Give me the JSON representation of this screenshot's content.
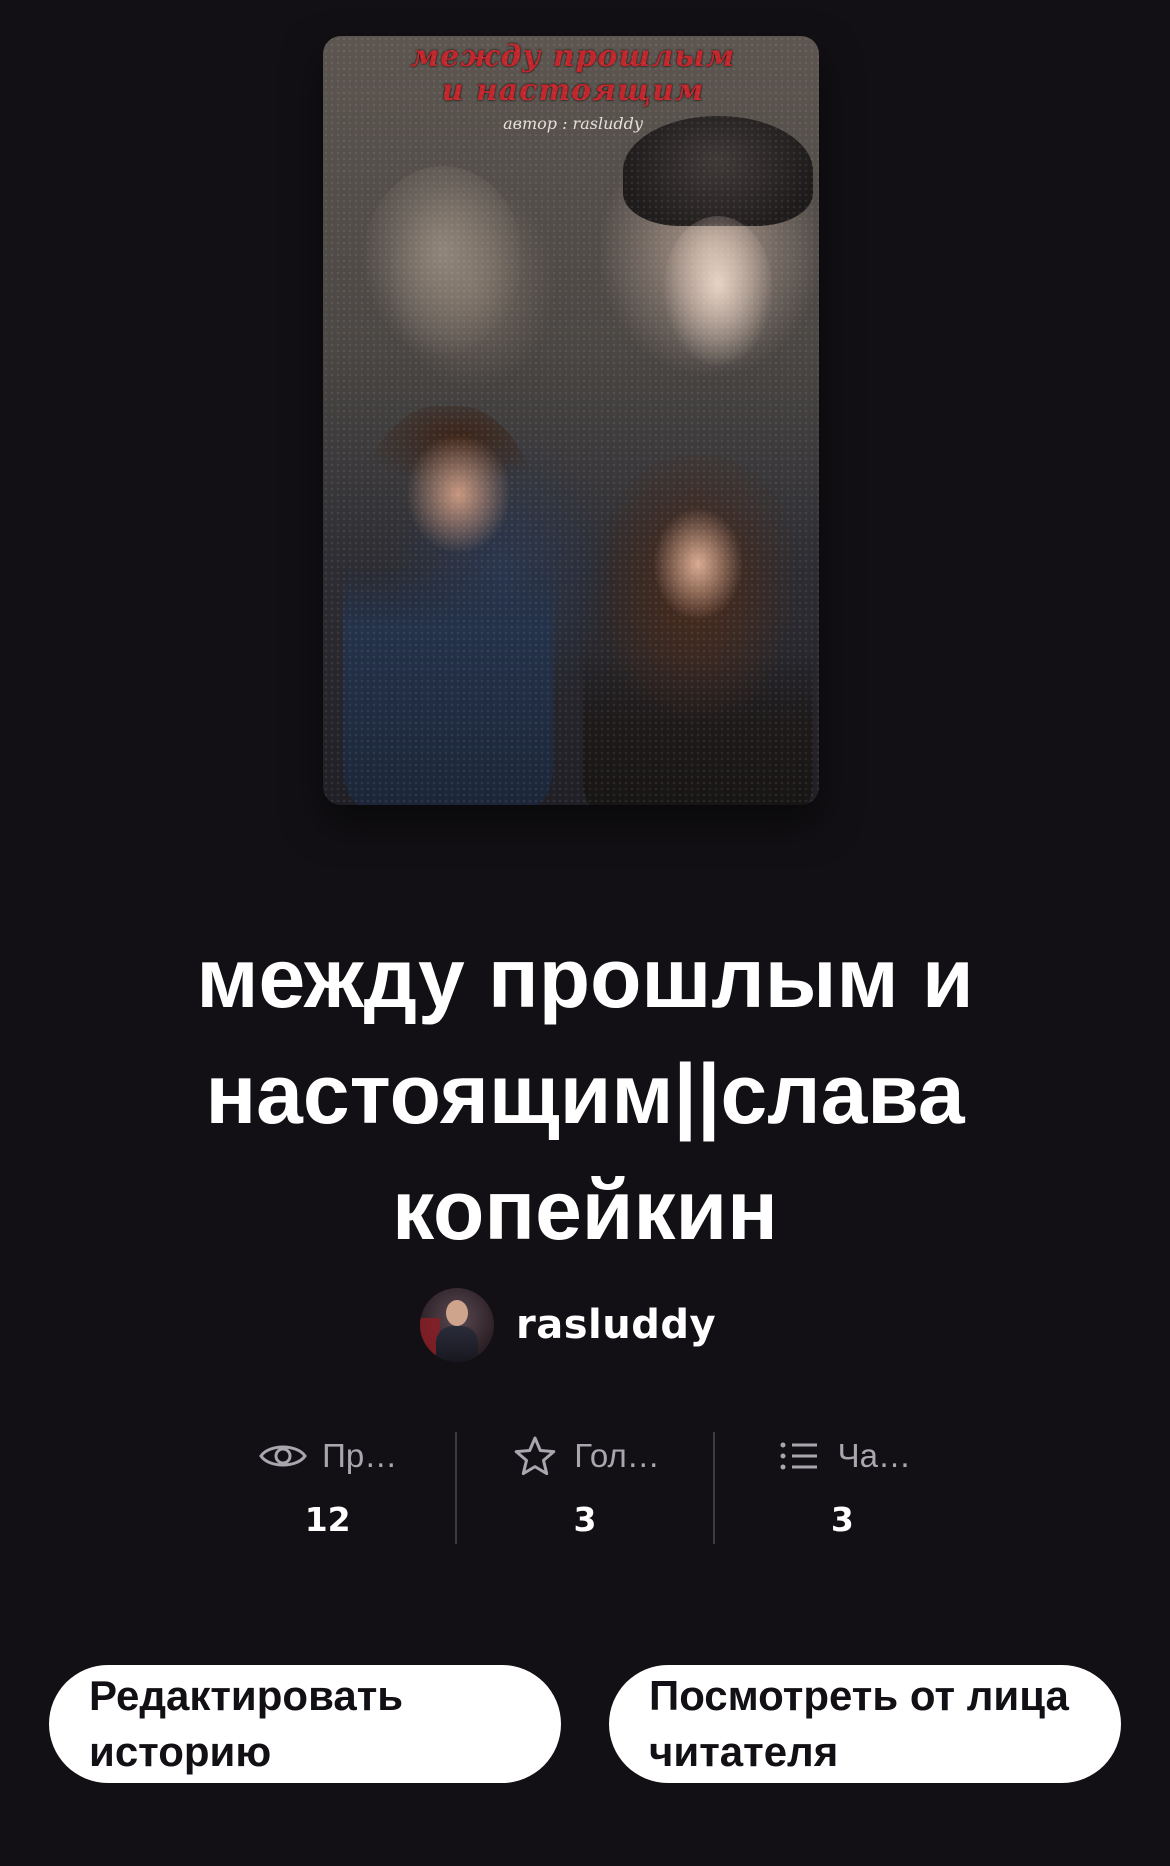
{
  "cover": {
    "title_lines": [
      "между прошлым",
      "и настоящим"
    ],
    "author_line": "автор : rasluddy"
  },
  "story": {
    "title": "между прошлым и настоящим||слава копейкин"
  },
  "author": {
    "name": "rasluddy"
  },
  "stats": [
    {
      "icon": "eye-icon",
      "label": "Пр…",
      "value": "12"
    },
    {
      "icon": "star-icon",
      "label": "Гол…",
      "value": "3"
    },
    {
      "icon": "list-icon",
      "label": "Ча…",
      "value": "3"
    }
  ],
  "actions": {
    "edit_label": "Редактировать историю",
    "preview_label": "Посмотреть от лица читателя"
  },
  "colors": {
    "background": "#121014",
    "text": "#ffffff",
    "muted": "#a9a6ad",
    "button_bg": "#ffffff",
    "button_text": "#121014",
    "cover_title": "#c0262c"
  }
}
